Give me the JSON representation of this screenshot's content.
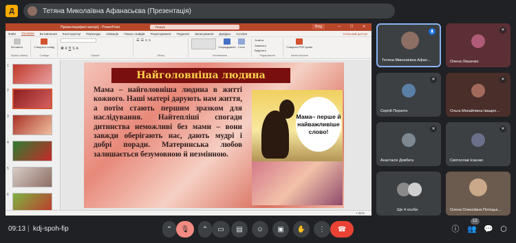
{
  "app": {
    "logo_text": "Д",
    "presenter_label": "Тетяна Миколаївна Афанасьєва (Презентація)"
  },
  "ppt": {
    "window_title": "Презентація(мої матері) - PowerPoint",
    "search_placeholder": "Пошук",
    "top_right_label": "Вхід",
    "menu": [
      "Файл",
      "Основне",
      "Вставлення",
      "Конструктор",
      "Переходи",
      "Анімація",
      "Показ слайдів",
      "Рецензування",
      "Подання",
      "Записування",
      "Довідка",
      "Acrobat"
    ],
    "share_label": "Спільний доступ",
    "ribbon": {
      "paste": "Вставити",
      "new_slide": "Створити слайд",
      "clipboard": "Буфер обміну",
      "slides": "Слайди",
      "font": "Шрифт",
      "paragraph": "Абзац",
      "drawing": "Малювання",
      "arrange": "Упорядкувати",
      "styles": "Стилі",
      "editing": "Редагування",
      "find": "Знайти",
      "replace": "Замінити",
      "select": "Виділити",
      "create_pdf": "Створити PDF-файл",
      "adobe": "Adobe Acrobat"
    },
    "thumbs": [
      "1",
      "2",
      "3",
      "4",
      "5",
      "6"
    ],
    "zoom": "+ 61%"
  },
  "slide": {
    "title": "Найголовніша людина",
    "body": "Мама – найголовніша людина в житті кожного. Наші матері дарують нам життя, а потім стають першим зразком для наслідування. Найтепліші спогади дитинства неможливі без мами – вони завжди оберігають нас, дають мудрі і добрі поради. Материнська любов залишається безумовною й незмінною.",
    "bubble": "Мама– перше й найважливіше слово!"
  },
  "participants": [
    {
      "name": "Тетяна Миколаївна Афан…",
      "state": "speaking",
      "color": "#8d6e63"
    },
    {
      "name": "Олена Ляшенко",
      "state": "muted",
      "color": "#b05b77"
    },
    {
      "name": "Сергій Перютін",
      "state": "muted",
      "color": "#5b7fa5"
    },
    {
      "name": "Ольга Михайлівна Іващен…",
      "state": "muted",
      "color": "#a36a5c"
    },
    {
      "name": "Анастасія Довбега",
      "state": "muted",
      "color": "#7d8891"
    },
    {
      "name": "Святослав Ісаєнко",
      "state": "muted",
      "color": "#6c6f8a"
    },
    {
      "name": "Ще 4 особи",
      "state": "group",
      "color": "#5f6368"
    },
    {
      "name": "Олена Олексіївна Потоцьк…",
      "state": "muted",
      "color": "#c9a98a"
    }
  ],
  "bottom": {
    "time": "09:13",
    "separator": "|",
    "meeting_code": "kdj-spoh-fip",
    "participants_badge": "12"
  }
}
